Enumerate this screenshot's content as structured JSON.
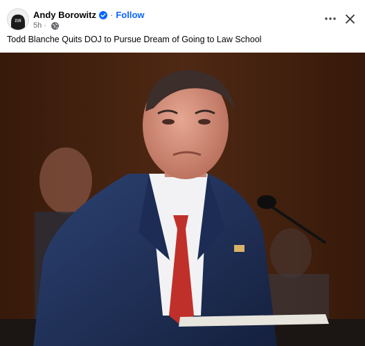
{
  "post": {
    "author": "Andy Borowitz",
    "separator": "·",
    "follow_label": "Follow",
    "time": "5h",
    "time_separator": "·",
    "text": "Todd Blanche Quits DOJ to Pursue Dream of Going to Law School",
    "avatar_text": "215"
  },
  "icons": {
    "verified": "verified-badge-icon",
    "audience": "globe-icon",
    "more": "more-options-icon",
    "close": "close-icon"
  },
  "colors": {
    "link": "#0866ff",
    "secondary_text": "#65676b",
    "primary_text": "#050505",
    "tie": "#c0302a",
    "suit": "#22345c"
  }
}
